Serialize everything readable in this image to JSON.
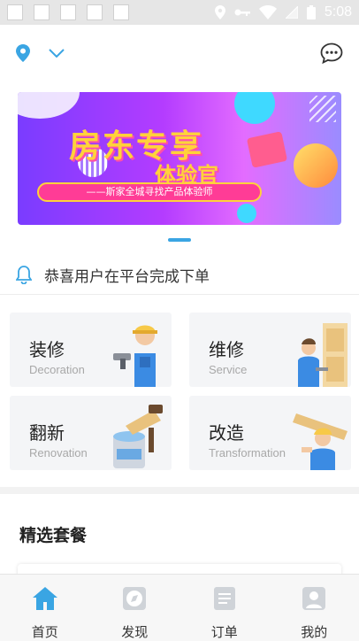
{
  "status_bar": {
    "time": "5:08"
  },
  "colors": {
    "accent": "#3aa5e3",
    "banner_text": "#ffd23a",
    "banner_pink": "#ff3c96"
  },
  "banner": {
    "title": "房东专享",
    "subtitle": "体验官",
    "pill_text": "——斯家全城寻找产品体验师"
  },
  "notice": {
    "text": "恭喜用户在平台完成下单"
  },
  "services": [
    {
      "title": "装修",
      "subtitle": "Decoration"
    },
    {
      "title": "维修",
      "subtitle": "Service"
    },
    {
      "title": "翻新",
      "subtitle": "Renovation"
    },
    {
      "title": "改造",
      "subtitle": "Transformation"
    }
  ],
  "section": {
    "title": "精选套餐"
  },
  "bottom_nav": [
    {
      "label": "首页",
      "icon": "home-icon",
      "active": true
    },
    {
      "label": "发现",
      "icon": "compass-icon",
      "active": false
    },
    {
      "label": "订单",
      "icon": "list-icon",
      "active": false
    },
    {
      "label": "我的",
      "icon": "user-icon",
      "active": false
    }
  ]
}
